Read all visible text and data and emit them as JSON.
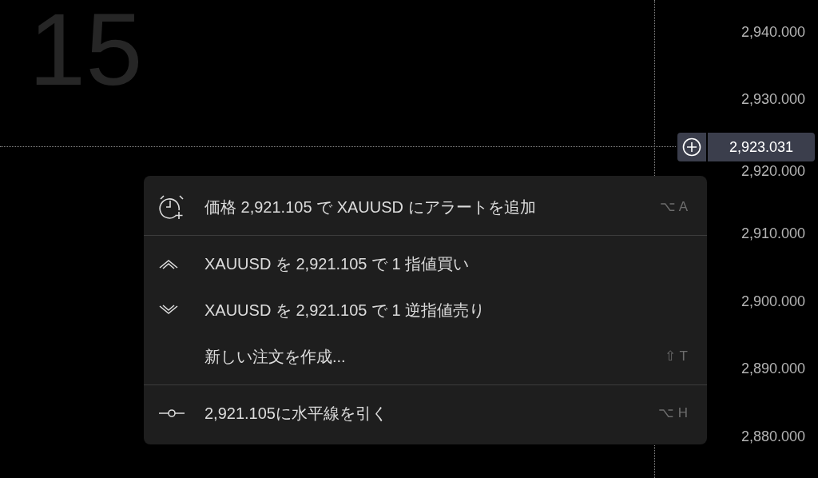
{
  "chart": {
    "interval_label": "15",
    "price_axis": [
      "2,940.000",
      "2,930.000",
      "2,920.000",
      "2,910.000",
      "2,900.000",
      "2,890.000",
      "2,880.000"
    ],
    "crosshair_price": "2,923.031"
  },
  "context_menu": {
    "sections": [
      [
        {
          "kind": "alarm",
          "label": "価格 2,921.105 で XAUUSD にアラートを追加",
          "shortcut": "⌥ A"
        }
      ],
      [
        {
          "kind": "buy",
          "label": "XAUUSD を 2,921.105 で 1 指値買い"
        },
        {
          "kind": "sell",
          "label": "XAUUSD を 2,921.105 で 1 逆指値売り"
        },
        {
          "kind": "plain",
          "label": "新しい注文を作成...",
          "shortcut": "⇧ T"
        }
      ],
      [
        {
          "kind": "hline",
          "label": "2,921.105に水平線を引く",
          "shortcut": "⌥ H"
        }
      ]
    ]
  }
}
